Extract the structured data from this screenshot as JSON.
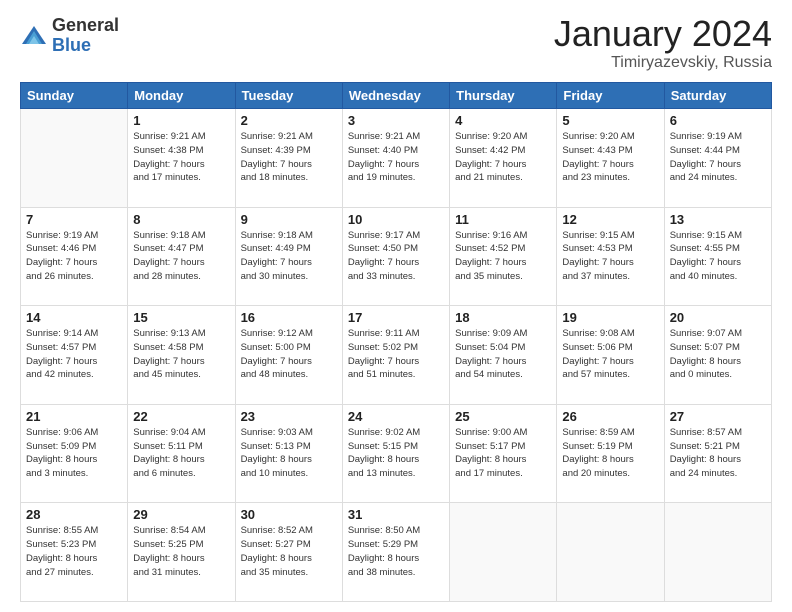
{
  "header": {
    "logo_general": "General",
    "logo_blue": "Blue",
    "month_title": "January 2024",
    "location": "Timiryazevskiy, Russia"
  },
  "days_of_week": [
    "Sunday",
    "Monday",
    "Tuesday",
    "Wednesday",
    "Thursday",
    "Friday",
    "Saturday"
  ],
  "weeks": [
    [
      {
        "day": "",
        "info": ""
      },
      {
        "day": "1",
        "info": "Sunrise: 9:21 AM\nSunset: 4:38 PM\nDaylight: 7 hours\nand 17 minutes."
      },
      {
        "day": "2",
        "info": "Sunrise: 9:21 AM\nSunset: 4:39 PM\nDaylight: 7 hours\nand 18 minutes."
      },
      {
        "day": "3",
        "info": "Sunrise: 9:21 AM\nSunset: 4:40 PM\nDaylight: 7 hours\nand 19 minutes."
      },
      {
        "day": "4",
        "info": "Sunrise: 9:20 AM\nSunset: 4:42 PM\nDaylight: 7 hours\nand 21 minutes."
      },
      {
        "day": "5",
        "info": "Sunrise: 9:20 AM\nSunset: 4:43 PM\nDaylight: 7 hours\nand 23 minutes."
      },
      {
        "day": "6",
        "info": "Sunrise: 9:19 AM\nSunset: 4:44 PM\nDaylight: 7 hours\nand 24 minutes."
      }
    ],
    [
      {
        "day": "7",
        "info": "Sunrise: 9:19 AM\nSunset: 4:46 PM\nDaylight: 7 hours\nand 26 minutes."
      },
      {
        "day": "8",
        "info": "Sunrise: 9:18 AM\nSunset: 4:47 PM\nDaylight: 7 hours\nand 28 minutes."
      },
      {
        "day": "9",
        "info": "Sunrise: 9:18 AM\nSunset: 4:49 PM\nDaylight: 7 hours\nand 30 minutes."
      },
      {
        "day": "10",
        "info": "Sunrise: 9:17 AM\nSunset: 4:50 PM\nDaylight: 7 hours\nand 33 minutes."
      },
      {
        "day": "11",
        "info": "Sunrise: 9:16 AM\nSunset: 4:52 PM\nDaylight: 7 hours\nand 35 minutes."
      },
      {
        "day": "12",
        "info": "Sunrise: 9:15 AM\nSunset: 4:53 PM\nDaylight: 7 hours\nand 37 minutes."
      },
      {
        "day": "13",
        "info": "Sunrise: 9:15 AM\nSunset: 4:55 PM\nDaylight: 7 hours\nand 40 minutes."
      }
    ],
    [
      {
        "day": "14",
        "info": "Sunrise: 9:14 AM\nSunset: 4:57 PM\nDaylight: 7 hours\nand 42 minutes."
      },
      {
        "day": "15",
        "info": "Sunrise: 9:13 AM\nSunset: 4:58 PM\nDaylight: 7 hours\nand 45 minutes."
      },
      {
        "day": "16",
        "info": "Sunrise: 9:12 AM\nSunset: 5:00 PM\nDaylight: 7 hours\nand 48 minutes."
      },
      {
        "day": "17",
        "info": "Sunrise: 9:11 AM\nSunset: 5:02 PM\nDaylight: 7 hours\nand 51 minutes."
      },
      {
        "day": "18",
        "info": "Sunrise: 9:09 AM\nSunset: 5:04 PM\nDaylight: 7 hours\nand 54 minutes."
      },
      {
        "day": "19",
        "info": "Sunrise: 9:08 AM\nSunset: 5:06 PM\nDaylight: 7 hours\nand 57 minutes."
      },
      {
        "day": "20",
        "info": "Sunrise: 9:07 AM\nSunset: 5:07 PM\nDaylight: 8 hours\nand 0 minutes."
      }
    ],
    [
      {
        "day": "21",
        "info": "Sunrise: 9:06 AM\nSunset: 5:09 PM\nDaylight: 8 hours\nand 3 minutes."
      },
      {
        "day": "22",
        "info": "Sunrise: 9:04 AM\nSunset: 5:11 PM\nDaylight: 8 hours\nand 6 minutes."
      },
      {
        "day": "23",
        "info": "Sunrise: 9:03 AM\nSunset: 5:13 PM\nDaylight: 8 hours\nand 10 minutes."
      },
      {
        "day": "24",
        "info": "Sunrise: 9:02 AM\nSunset: 5:15 PM\nDaylight: 8 hours\nand 13 minutes."
      },
      {
        "day": "25",
        "info": "Sunrise: 9:00 AM\nSunset: 5:17 PM\nDaylight: 8 hours\nand 17 minutes."
      },
      {
        "day": "26",
        "info": "Sunrise: 8:59 AM\nSunset: 5:19 PM\nDaylight: 8 hours\nand 20 minutes."
      },
      {
        "day": "27",
        "info": "Sunrise: 8:57 AM\nSunset: 5:21 PM\nDaylight: 8 hours\nand 24 minutes."
      }
    ],
    [
      {
        "day": "28",
        "info": "Sunrise: 8:55 AM\nSunset: 5:23 PM\nDaylight: 8 hours\nand 27 minutes."
      },
      {
        "day": "29",
        "info": "Sunrise: 8:54 AM\nSunset: 5:25 PM\nDaylight: 8 hours\nand 31 minutes."
      },
      {
        "day": "30",
        "info": "Sunrise: 8:52 AM\nSunset: 5:27 PM\nDaylight: 8 hours\nand 35 minutes."
      },
      {
        "day": "31",
        "info": "Sunrise: 8:50 AM\nSunset: 5:29 PM\nDaylight: 8 hours\nand 38 minutes."
      },
      {
        "day": "",
        "info": ""
      },
      {
        "day": "",
        "info": ""
      },
      {
        "day": "",
        "info": ""
      }
    ]
  ]
}
